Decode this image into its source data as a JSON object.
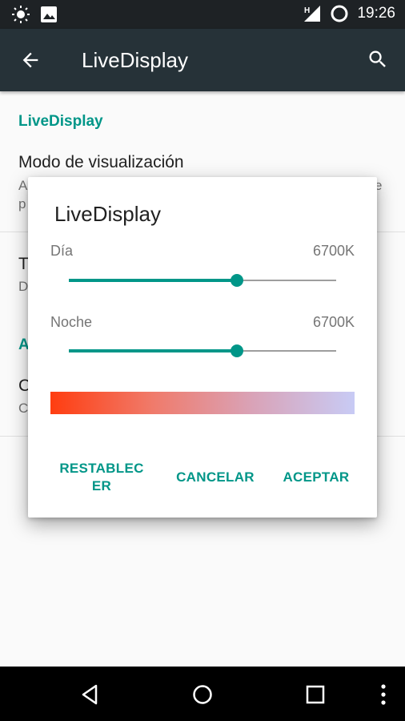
{
  "status_bar": {
    "time": "19:26",
    "network_label": "H",
    "icons": [
      "brightness-icon",
      "image-notification-icon",
      "signal-icon",
      "battery-icon"
    ]
  },
  "app_bar": {
    "title": "LiveDisplay",
    "icons": [
      "back-arrow-icon",
      "search-icon"
    ]
  },
  "settings": {
    "section1_header": "LiveDisplay",
    "pref1_title": "Modo de visualización",
    "pref1_summary_start": "A",
    "pref1_summary_end": "e",
    "pref1_summary_line2": "p",
    "pref2_title": "T",
    "pref2_summary": "D",
    "section2_header": "A",
    "pref3_title": "C",
    "pref3_summary": "C"
  },
  "dialog": {
    "title": "LiveDisplay",
    "day": {
      "label": "Día",
      "value": "6700K",
      "level": 0.63
    },
    "night": {
      "label": "Noche",
      "value": "6700K",
      "level": 0.63
    },
    "buttons": {
      "reset_line1": "RESTABLEC",
      "reset_line2": "ER",
      "cancel": "CANCELAR",
      "accept": "ACEPTAR"
    },
    "gradient_colors": [
      "#ff3d10",
      "#f07a6a",
      "#d9a3b8",
      "#c8cbf5"
    ],
    "accent_color": "#009688"
  },
  "nav_bar": {
    "icons": [
      "back-triangle-icon",
      "home-circle-icon",
      "recents-square-icon",
      "menu-dots-icon"
    ]
  }
}
